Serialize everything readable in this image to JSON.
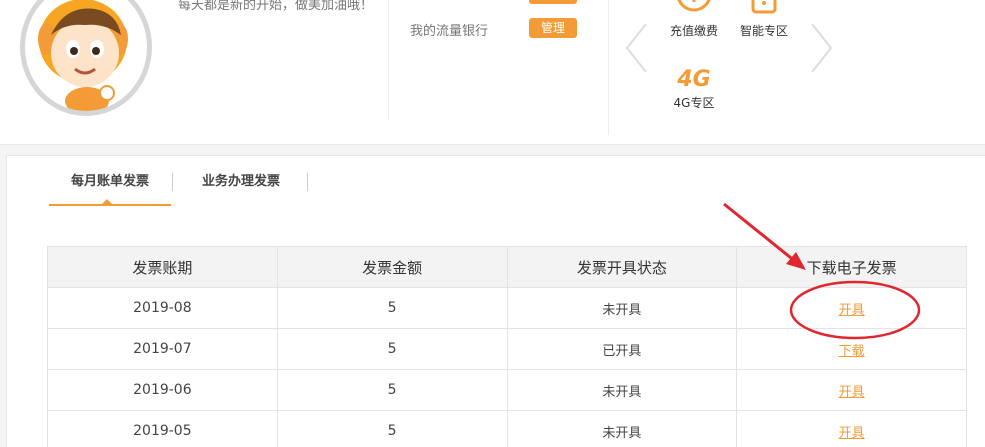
{
  "user": {
    "greeting": "每天都是新的开始，做美加油哦！",
    "flow_bank_label": "我的流量银行",
    "manage_label": "管理"
  },
  "services": [
    {
      "label": "充值缴费",
      "icon": "recharge-icon"
    },
    {
      "label": "智能专区",
      "icon": "smart-zone-icon"
    },
    {
      "label": "4G专区",
      "icon": "4g-zone-icon"
    }
  ],
  "tabs": [
    "每月账单发票",
    "业务办理发票"
  ],
  "table": {
    "headers": [
      "发票账期",
      "发票金额",
      "发票开具状态",
      "下载电子发票"
    ],
    "rows": [
      {
        "period": "2019-08",
        "amount": "5",
        "status": "未开具",
        "action": "开具"
      },
      {
        "period": "2019-07",
        "amount": "5",
        "status": "已开具",
        "action": "下载"
      },
      {
        "period": "2019-06",
        "amount": "5",
        "status": "未开具",
        "action": "开具"
      },
      {
        "period": "2019-05",
        "amount": "5",
        "status": "未开具",
        "action": "开具"
      }
    ]
  },
  "colors": {
    "accent": "#f39b36",
    "annotation": "#e0272f"
  }
}
